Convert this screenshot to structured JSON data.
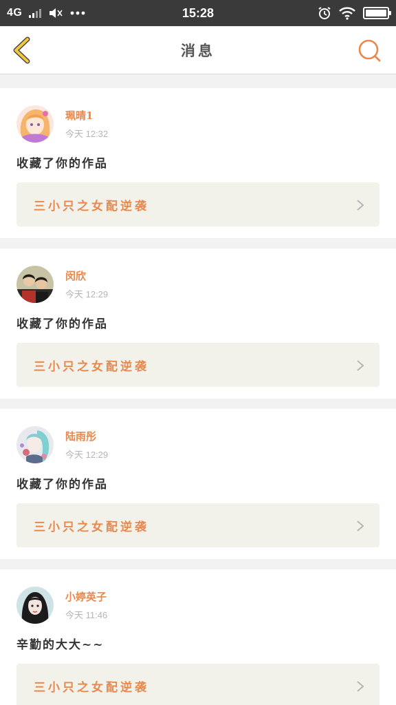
{
  "status_bar": {
    "network": "4G",
    "time": "15:28",
    "icons": [
      "signal-icon",
      "mute-icon",
      "more-dots-icon",
      "alarm-icon",
      "wifi-icon",
      "battery-icon"
    ]
  },
  "nav": {
    "title": "消息",
    "back_icon": "chevron-left-icon",
    "search_icon": "search-icon"
  },
  "colors": {
    "accent": "#e8884c",
    "back_arrow": "#f3c93b",
    "status_bar_bg": "#3a3a3a",
    "card_link_bg": "#f3f2ea"
  },
  "messages": [
    {
      "author": "珮晴1",
      "time": "今天 12:32",
      "text": "收藏了你的作品",
      "work_title": "三小只之女配逆袭"
    },
    {
      "author": "闵欣",
      "time": "今天 12:29",
      "text": "收藏了你的作品",
      "work_title": "三小只之女配逆袭"
    },
    {
      "author": "陆雨彤",
      "time": "今天 12:29",
      "text": "收藏了你的作品",
      "work_title": "三小只之女配逆袭"
    },
    {
      "author": "小婷英子",
      "time": "今天 11:46",
      "text": "辛勤的大大~~",
      "work_title": "三小只之女配逆袭"
    }
  ]
}
